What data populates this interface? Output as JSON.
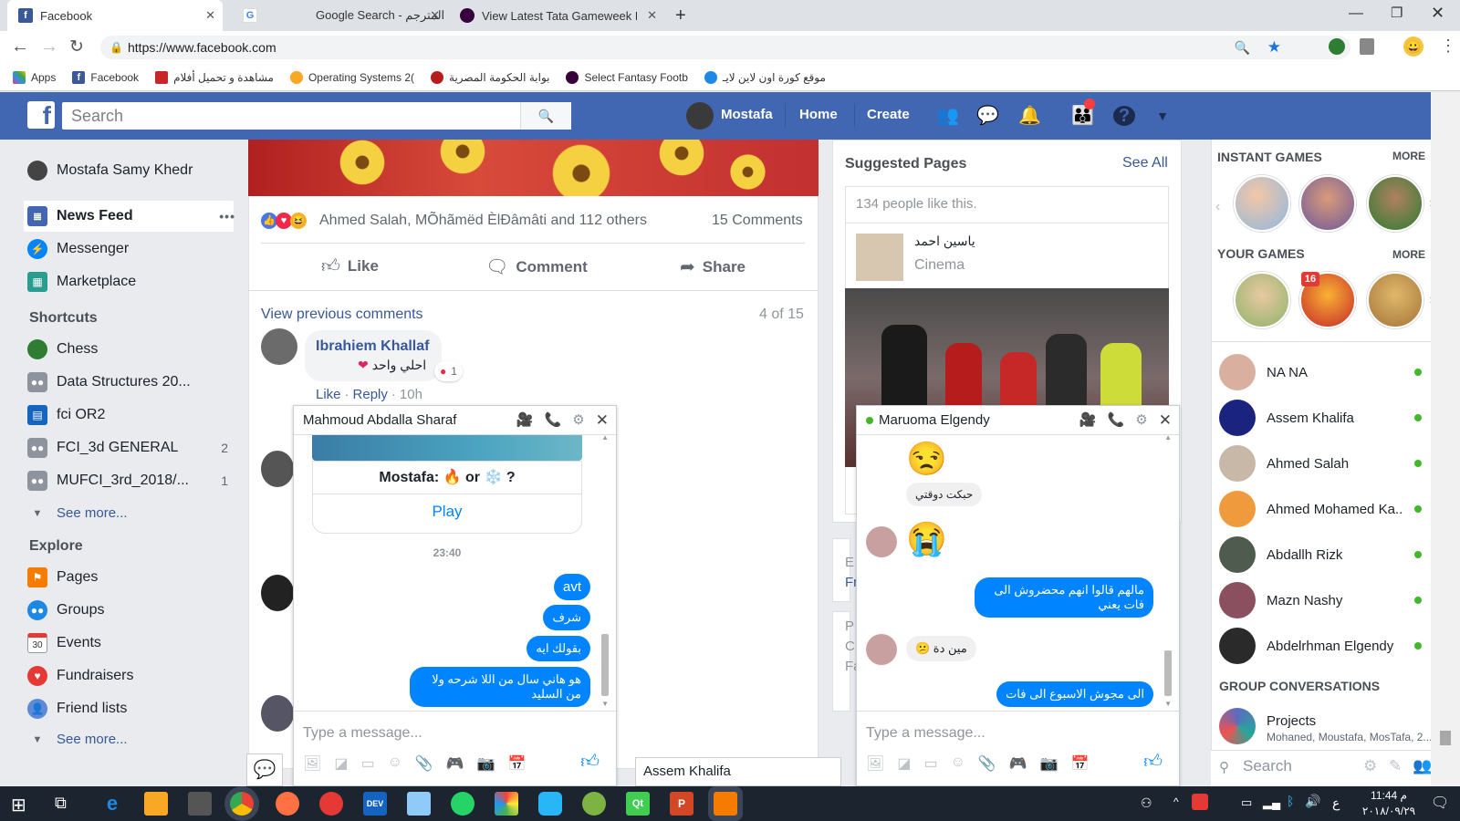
{
  "browser": {
    "tabs": [
      {
        "title": "Facebook"
      },
      {
        "title": "Google Search - المترجم"
      },
      {
        "title": "View Latest Tata Gameweek Poin"
      }
    ],
    "url": "https://www.facebook.com",
    "bookmarks": [
      "Apps",
      "Facebook",
      "مشاهدة و تحميل أفلام",
      "Operating Systems 2(",
      "بوابة الحكومة المصرية",
      "Select Fantasy Footb",
      "موقع كورة اون لاين لايـ"
    ]
  },
  "fb": {
    "search_placeholder": "Search",
    "user": "Mostafa",
    "home": "Home",
    "create": "Create",
    "left": {
      "profile": "Mostafa Samy Khedr",
      "main": [
        {
          "label": "News Feed"
        },
        {
          "label": "Messenger"
        },
        {
          "label": "Marketplace"
        }
      ],
      "more_dots": "•••",
      "shortcuts_title": "Shortcuts",
      "shortcuts": [
        {
          "label": "Chess",
          "count": ""
        },
        {
          "label": "Data Structures 20...",
          "count": ""
        },
        {
          "label": "fci OR2",
          "count": ""
        },
        {
          "label": "FCI_3d GENERAL",
          "count": "2"
        },
        {
          "label": "MUFCI_3rd_2018/...",
          "count": "1"
        }
      ],
      "see_more": "See more...",
      "explore_title": "Explore",
      "explore": [
        {
          "label": "Pages",
          "icon": "flag-icon"
        },
        {
          "label": "Groups",
          "icon": "groups-icon"
        },
        {
          "label": "Events",
          "icon": "calendar-icon",
          "icon_text": "30"
        },
        {
          "label": "Fundraisers",
          "icon": "heart-icon"
        },
        {
          "label": "Friend lists",
          "icon": "friends-icon"
        }
      ],
      "see_more2": "See more..."
    },
    "post": {
      "reactions": "Ahmed Salah, MÕhãmëd ÈlĐâmâti and 112 others",
      "comments_count": "15 Comments",
      "like": "Like",
      "comment": "Comment",
      "share": "Share",
      "view_previous": "View previous comments",
      "pager": "4 of 15",
      "comment1": {
        "author": "Ibrahiem Khallaf",
        "text": "احلي واحد",
        "react_count": "1",
        "like": "Like",
        "reply": "Reply",
        "time": "10h"
      }
    },
    "suggested": {
      "title": "Suggested Pages",
      "see_all": "See All",
      "likes": "134 people like this.",
      "page_name": "ياسين احمد",
      "page_cat": "Cinema",
      "partial": [
        "E",
        "Fr",
        "P",
        "C",
        "Fa"
      ]
    },
    "right": {
      "instant_games": "INSTANT GAMES",
      "more1": "MORE",
      "your_games": "YOUR GAMES",
      "more2": "MORE",
      "badge": "16",
      "contacts": [
        {
          "name": "NA NA"
        },
        {
          "name": "Assem Khalifa"
        },
        {
          "name": "Ahmed Salah"
        },
        {
          "name": "Ahmed Mohamed Ka..."
        },
        {
          "name": "Abdallh Rizk"
        },
        {
          "name": "Mazn Nashy"
        },
        {
          "name": "Abdelrhman Elgendy"
        }
      ],
      "group_title": "GROUP CONVERSATIONS",
      "group": {
        "name": "Projects",
        "members": "Mohaned, Moustafa, MosTafa, 2..."
      },
      "search": "Search"
    },
    "chat1": {
      "name": "Mahmoud Abdalla Sharaf",
      "game_prompt": "Mostafa: 🔥 or ❄️ ?",
      "play": "Play",
      "time": "23:40",
      "msgs": [
        "avt",
        "شرف",
        "بقولك ايه",
        "هو هاني سال من اللا شرحه ولا من السليد"
      ],
      "placeholder": "Type a message..."
    },
    "chat2": {
      "name": "Maruoma Elgendy",
      "emoji1": "😒",
      "msg1": "حبكت دوقتي",
      "emoji2": "😭",
      "msg2": "مالهم قالوا انهم محضروش الى فات يعني",
      "msg3": "مين دة 😕",
      "msg4": "الى مجوش الاسبوع الى فات",
      "placeholder": "Type a message..."
    },
    "minimized_chat": "Assem Khalifa"
  },
  "taskbar": {
    "time": "11:44 م",
    "date": "٢٠١٨/٠٩/٢٩",
    "lang": "ع"
  }
}
